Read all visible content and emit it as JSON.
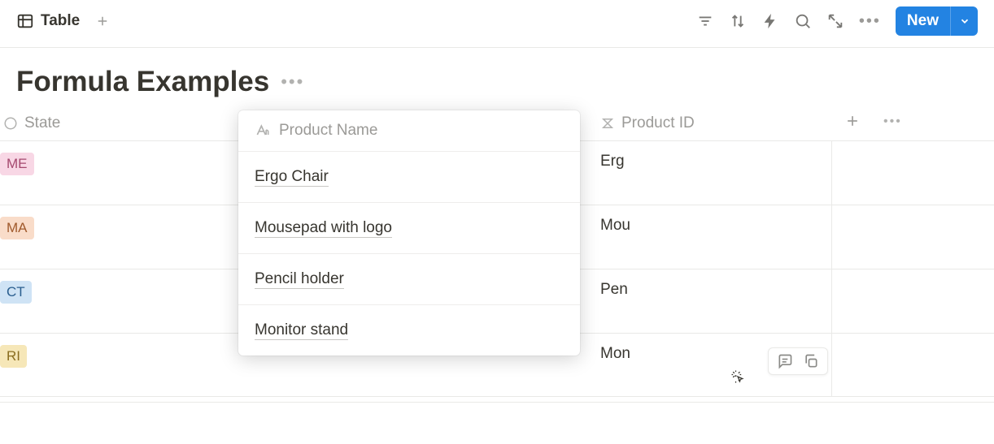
{
  "toolbar": {
    "view_label": "Table",
    "new_label": "New"
  },
  "title": "Formula Examples",
  "columns": {
    "state": "State",
    "product_name": "Product Name",
    "product_id": "Product ID"
  },
  "rows": [
    {
      "state_tag": "ME",
      "state_color": "tag-pink",
      "product_name": "Ergo Chair",
      "product_id": "Erg"
    },
    {
      "state_tag": "MA",
      "state_color": "tag-orange",
      "product_name": "Mousepad with logo",
      "product_id": "Mou"
    },
    {
      "state_tag": "CT",
      "state_color": "tag-blue",
      "product_name": "Pencil holder",
      "product_id": "Pen"
    },
    {
      "state_tag": "RI",
      "state_color": "tag-yellow",
      "product_name": "Monitor stand",
      "product_id": "Mon"
    }
  ]
}
